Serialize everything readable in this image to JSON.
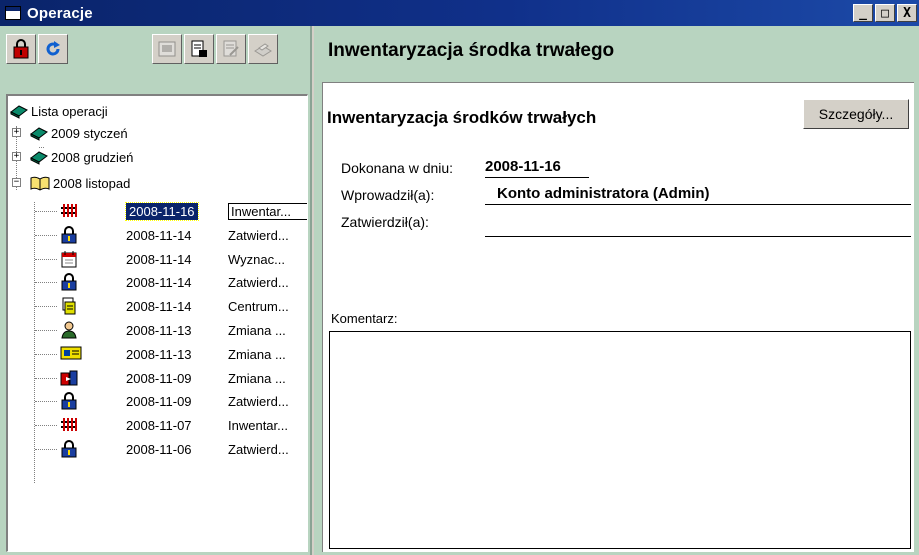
{
  "window": {
    "title": "Operacje"
  },
  "title_buttons": {
    "minimize": "_",
    "maximize": "□",
    "close": "X"
  },
  "toolbar": {
    "buttons": [
      {
        "icon": "lock-icon"
      },
      {
        "icon": "refresh-icon"
      },
      {
        "icon": "fk-icon"
      },
      {
        "icon": "find-document-icon"
      },
      {
        "icon": "document-edit-icon"
      },
      {
        "icon": "print-icon"
      }
    ]
  },
  "tree": {
    "root": "Lista operacji",
    "groups": [
      {
        "label": "2009 styczeń",
        "expanded": false
      },
      {
        "label": "2008 grudzień",
        "expanded": false
      },
      {
        "label": "2008 listopad",
        "expanded": true
      }
    ],
    "items": [
      {
        "date": "2008-11-16",
        "name": "Inwentar...",
        "icon": "inventory-icon",
        "selected": true
      },
      {
        "date": "2008-11-14",
        "name": "Zatwierd...",
        "icon": "padlock-icon"
      },
      {
        "date": "2008-11-14",
        "name": "Wyznac...",
        "icon": "calendar-icon"
      },
      {
        "date": "2008-11-14",
        "name": "Zatwierd...",
        "icon": "padlock-icon"
      },
      {
        "date": "2008-11-14",
        "name": "Centrum...",
        "icon": "document-stack-icon"
      },
      {
        "date": "2008-11-13",
        "name": "Zmiana ...",
        "icon": "person-icon"
      },
      {
        "date": "2008-11-13",
        "name": "Zmiana ...",
        "icon": "id-card-icon"
      },
      {
        "date": "2008-11-09",
        "name": "Zmiana ...",
        "icon": "transfer-icon"
      },
      {
        "date": "2008-11-09",
        "name": "Zatwierd...",
        "icon": "padlock-icon"
      },
      {
        "date": "2008-11-07",
        "name": "Inwentar...",
        "icon": "inventory-icon"
      },
      {
        "date": "2008-11-06",
        "name": "Zatwierd...",
        "icon": "padlock-icon"
      }
    ]
  },
  "main": {
    "header": "Inwentaryzacja środka trwałego",
    "form_title": "Inwentaryzacja środków trwałych",
    "details_button": "Szczegóły...",
    "fields": {
      "date_label": "Dokonana w dniu:",
      "date_value": "2008-11-16",
      "entered_label": "Wprowadził(a):",
      "entered_value": "Konto administratora (Admin)",
      "approved_label": "Zatwierdził(a):",
      "approved_value": ""
    },
    "comment_label": "Komentarz:",
    "comment_value": ""
  },
  "colors": {
    "titlebar": "#0a246a",
    "panel_bg": "#b8d4c0",
    "selection": "#0a246a"
  }
}
